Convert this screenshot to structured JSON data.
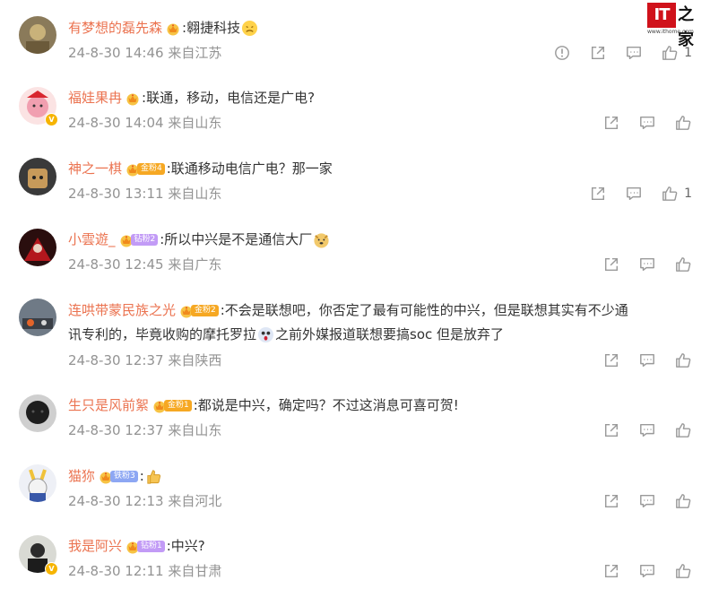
{
  "watermark": {
    "logo": "IT",
    "cn": "之家",
    "url": "www.ithome.com"
  },
  "comments": [
    {
      "name": "有梦想的磊先森",
      "medal": "",
      "content": ":翱捷科技",
      "time": "24-8-30 14:46",
      "location": "来自江苏",
      "likes": "1",
      "report": true,
      "vip": false
    },
    {
      "name": "福娃果冉",
      "medal": "",
      "content": ":联通，移动，电信还是广电?",
      "time": "24-8-30 14:04",
      "location": "来自山东",
      "likes": "",
      "report": false,
      "vip": true
    },
    {
      "name": "神之一棋",
      "medal": "金粉4",
      "content": ":联通移动电信广电？那一家",
      "time": "24-8-30 13:11",
      "location": "来自山东",
      "likes": "1",
      "report": false,
      "vip": false
    },
    {
      "name": "小雲遊_",
      "medal": "钻粉2",
      "content": ":所以中兴是不是通信大厂",
      "time": "24-8-30 12:45",
      "location": "来自广东",
      "likes": "",
      "report": false,
      "vip": false
    },
    {
      "name": "连哄带蒙民族之光",
      "medal": "金粉2",
      "content": ":不会是联想吧，你否定了最有可能性的中兴，但是联想其实有不少通",
      "content2": "讯专利的，毕竟收购的摩托罗拉",
      "content3": "之前外媒报道联想要搞soc 但是放弃了",
      "time": "24-8-30 12:37",
      "location": "来自陕西",
      "likes": "",
      "report": false,
      "vip": false
    },
    {
      "name": "生只是风前絮",
      "medal": "金粉1",
      "content": ":都说是中兴，确定吗？不过这消息可喜可贺!",
      "time": "24-8-30 12:37",
      "location": "来自山东",
      "likes": "",
      "report": false,
      "vip": false
    },
    {
      "name": "猫狝",
      "medal": "铁粉3",
      "content": ":",
      "time": "24-8-30 12:13",
      "location": "来自河北",
      "likes": "",
      "report": false,
      "vip": false
    },
    {
      "name": "我是阿兴",
      "medal": "钻粉1",
      "content": ":中兴?",
      "time": "24-8-30 12:11",
      "location": "来自甘肃",
      "likes": "",
      "report": false,
      "vip": true
    }
  ],
  "icon_names": [
    "report-icon",
    "share-icon",
    "comment-icon",
    "like-icon"
  ],
  "colors": {
    "name": "#eb7350",
    "meta": "#939393",
    "text": "#333333",
    "gold_badge": "#f6a823",
    "diamond_badge": "#c29bf6",
    "iron_badge": "#8da7f3"
  }
}
